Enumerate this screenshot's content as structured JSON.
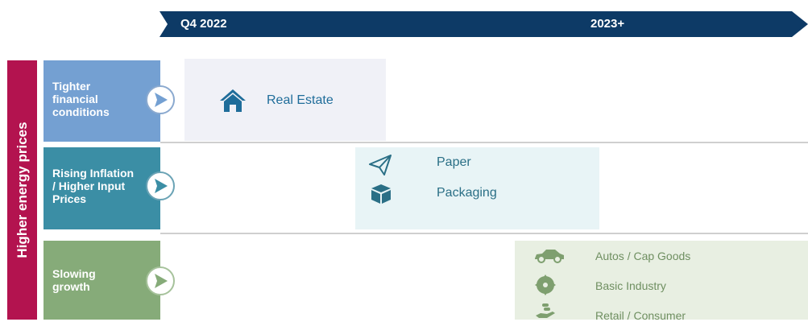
{
  "timeline": {
    "period_1": "Q4 2022",
    "period_2": "2023+"
  },
  "side_bar": {
    "label": "Higher energy prices"
  },
  "drivers": [
    {
      "lines": [
        "Tighter",
        "financial",
        "conditions"
      ]
    },
    {
      "lines": [
        "Rising Inflation",
        "/ Higher Input",
        "Prices"
      ]
    },
    {
      "lines": [
        "Slowing",
        "growth"
      ]
    }
  ],
  "sectors": {
    "real_estate": {
      "label": "Real Estate",
      "icon": "house-icon"
    },
    "paper": {
      "label": "Paper",
      "icon": "paper-plane-icon"
    },
    "packaging": {
      "label": "Packaging",
      "icon": "box-icon"
    },
    "autos": {
      "label": "Autos / Cap Goods",
      "icon": "car-icon"
    },
    "basic_industry": {
      "label": "Basic Industry",
      "icon": "saw-blade-icon"
    },
    "retail": {
      "label": "Retail / Consumer",
      "icon": "hand-coins-icon"
    }
  },
  "colors": {
    "timeline": "#0d3a66",
    "side_bar": "#b3134f",
    "driver_1": "#74a0d2",
    "driver_2": "#3b8ea5",
    "driver_3": "#86ab79",
    "box_1": "#f0f1f7",
    "box_2": "#e8f4f6",
    "box_3": "#e8efe2"
  }
}
